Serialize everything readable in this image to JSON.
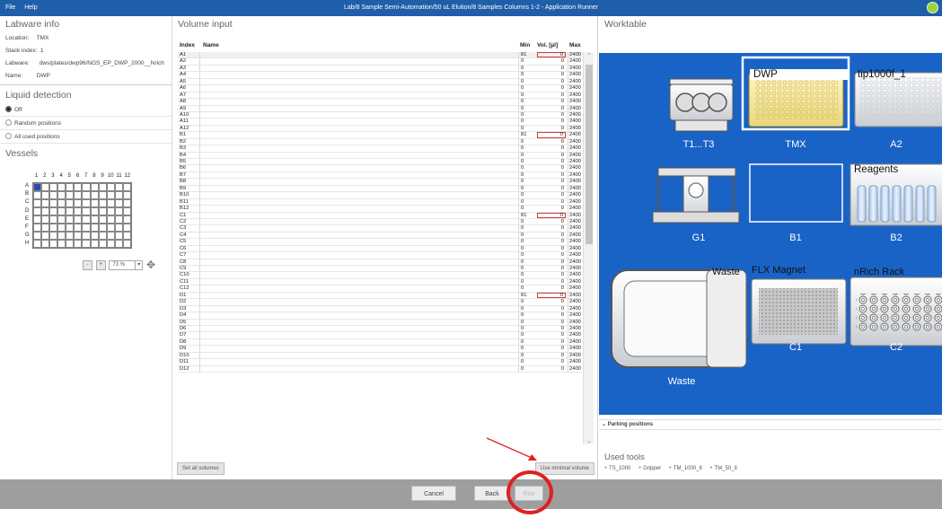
{
  "titlebar": {
    "menu": [
      "File",
      "Help"
    ],
    "title": "Lab/8 Sample Semi-Automation/50 uL Elution/8 Samples Columns 1-2 - Application Runner"
  },
  "labware_info": {
    "title": "Labware info",
    "location_label": "Location:",
    "location": "TMX",
    "stack_label": "Stack index:",
    "stack": "1",
    "labware_label": "Labware:",
    "labware": "dws/plates/dwp96/NGS_EP_DWP_2000__Nrich",
    "name_label": "Name:",
    "name": "DWP"
  },
  "liquid_detection": {
    "title": "Liquid detection",
    "options": [
      "Off",
      "Random positions",
      "All used positions"
    ],
    "selected": "Off"
  },
  "vessels": {
    "title": "Vessels",
    "columns": [
      "1",
      "2",
      "3",
      "4",
      "5",
      "6",
      "7",
      "8",
      "9",
      "10",
      "11",
      "12"
    ],
    "rows": [
      "A",
      "B",
      "C",
      "D",
      "E",
      "F",
      "G",
      "H"
    ],
    "zoom": "73 %",
    "minus": "-",
    "plus": "+"
  },
  "volume_input": {
    "title": "Volume input",
    "headers": {
      "index": "Index",
      "name": "Name",
      "min": "Min",
      "vol": "Vol. [µl]",
      "max": "Max"
    },
    "rows": [
      {
        "i": "A1",
        "min": "81",
        "vol": "0",
        "max": "2400",
        "hl": true
      },
      {
        "i": "A2",
        "min": "0",
        "vol": "0",
        "max": "2400"
      },
      {
        "i": "A3",
        "min": "0",
        "vol": "0",
        "max": "2400"
      },
      {
        "i": "A4",
        "min": "0",
        "vol": "0",
        "max": "2400"
      },
      {
        "i": "A5",
        "min": "0",
        "vol": "0",
        "max": "2400"
      },
      {
        "i": "A6",
        "min": "0",
        "vol": "0",
        "max": "2400"
      },
      {
        "i": "A7",
        "min": "0",
        "vol": "0",
        "max": "2400"
      },
      {
        "i": "A8",
        "min": "0",
        "vol": "0",
        "max": "2400"
      },
      {
        "i": "A9",
        "min": "0",
        "vol": "0",
        "max": "2400"
      },
      {
        "i": "A10",
        "min": "0",
        "vol": "0",
        "max": "2400"
      },
      {
        "i": "A11",
        "min": "0",
        "vol": "0",
        "max": "2400"
      },
      {
        "i": "A12",
        "min": "0",
        "vol": "0",
        "max": "2400"
      },
      {
        "i": "B1",
        "min": "81",
        "vol": "0",
        "max": "2400",
        "hl": true
      },
      {
        "i": "B2",
        "min": "0",
        "vol": "0",
        "max": "2400"
      },
      {
        "i": "B3",
        "min": "0",
        "vol": "0",
        "max": "2400"
      },
      {
        "i": "B4",
        "min": "0",
        "vol": "0",
        "max": "2400"
      },
      {
        "i": "B5",
        "min": "0",
        "vol": "0",
        "max": "2400"
      },
      {
        "i": "B6",
        "min": "0",
        "vol": "0",
        "max": "2400"
      },
      {
        "i": "B7",
        "min": "0",
        "vol": "0",
        "max": "2400"
      },
      {
        "i": "B8",
        "min": "0",
        "vol": "0",
        "max": "2400"
      },
      {
        "i": "B9",
        "min": "0",
        "vol": "0",
        "max": "2400"
      },
      {
        "i": "B10",
        "min": "0",
        "vol": "0",
        "max": "2400"
      },
      {
        "i": "B11",
        "min": "0",
        "vol": "0",
        "max": "2400"
      },
      {
        "i": "B12",
        "min": "0",
        "vol": "0",
        "max": "2400"
      },
      {
        "i": "C1",
        "min": "81",
        "vol": "0",
        "max": "2400",
        "hl": true
      },
      {
        "i": "C2",
        "min": "0",
        "vol": "0",
        "max": "2400"
      },
      {
        "i": "C3",
        "min": "0",
        "vol": "0",
        "max": "2400"
      },
      {
        "i": "C4",
        "min": "0",
        "vol": "0",
        "max": "2400"
      },
      {
        "i": "C5",
        "min": "0",
        "vol": "0",
        "max": "2400"
      },
      {
        "i": "C6",
        "min": "0",
        "vol": "0",
        "max": "2400"
      },
      {
        "i": "C7",
        "min": "0",
        "vol": "0",
        "max": "2400"
      },
      {
        "i": "C8",
        "min": "0",
        "vol": "0",
        "max": "2400"
      },
      {
        "i": "C9",
        "min": "0",
        "vol": "0",
        "max": "2400"
      },
      {
        "i": "C10",
        "min": "0",
        "vol": "0",
        "max": "2400"
      },
      {
        "i": "C11",
        "min": "0",
        "vol": "0",
        "max": "2400"
      },
      {
        "i": "C12",
        "min": "0",
        "vol": "0",
        "max": "2400"
      },
      {
        "i": "D1",
        "min": "81",
        "vol": "0",
        "max": "2400",
        "hl": true
      },
      {
        "i": "D2",
        "min": "0",
        "vol": "0",
        "max": "2400"
      },
      {
        "i": "D3",
        "min": "0",
        "vol": "0",
        "max": "2400"
      },
      {
        "i": "D4",
        "min": "0",
        "vol": "0",
        "max": "2400"
      },
      {
        "i": "D5",
        "min": "0",
        "vol": "0",
        "max": "2400"
      },
      {
        "i": "D6",
        "min": "0",
        "vol": "0",
        "max": "2400"
      },
      {
        "i": "D7",
        "min": "0",
        "vol": "0",
        "max": "2400"
      },
      {
        "i": "D8",
        "min": "0",
        "vol": "0",
        "max": "2400"
      },
      {
        "i": "D9",
        "min": "0",
        "vol": "0",
        "max": "2400"
      },
      {
        "i": "D10",
        "min": "0",
        "vol": "0",
        "max": "2400"
      },
      {
        "i": "D11",
        "min": "0",
        "vol": "0",
        "max": "2400"
      },
      {
        "i": "D12",
        "min": "0",
        "vol": "0",
        "max": "2400"
      }
    ],
    "set_all": "Set all volumes",
    "use_minimal": "Use minimal volume"
  },
  "worktable": {
    "title": "Worktable",
    "positions": {
      "t1t3": "T1...T3",
      "tmx": "TMX",
      "a2": "A2",
      "g1": "G1",
      "b1": "B1",
      "b2": "B2",
      "c1": "C1",
      "c2": "C2",
      "waste": "Waste"
    },
    "labware": {
      "dwp": "DWP",
      "tip": "tip1000f_1",
      "reagents": "Reagents",
      "waste": "Waste",
      "flx": "FLX Magnet",
      "nrich": "nRich Rack"
    },
    "parking": "Parking positions",
    "used_tools_title": "Used tools",
    "tools": [
      "TS_1000",
      "Gripper",
      "TM_1000_8",
      "TM_50_8"
    ]
  },
  "footer": {
    "cancel": "Cancel",
    "back": "Back",
    "run": "Run"
  },
  "colors": {
    "deck": "#1a63c6",
    "titlebar": "#1f5ea8",
    "highlight": "#e02020",
    "selected_well": "#2a4bb5"
  }
}
